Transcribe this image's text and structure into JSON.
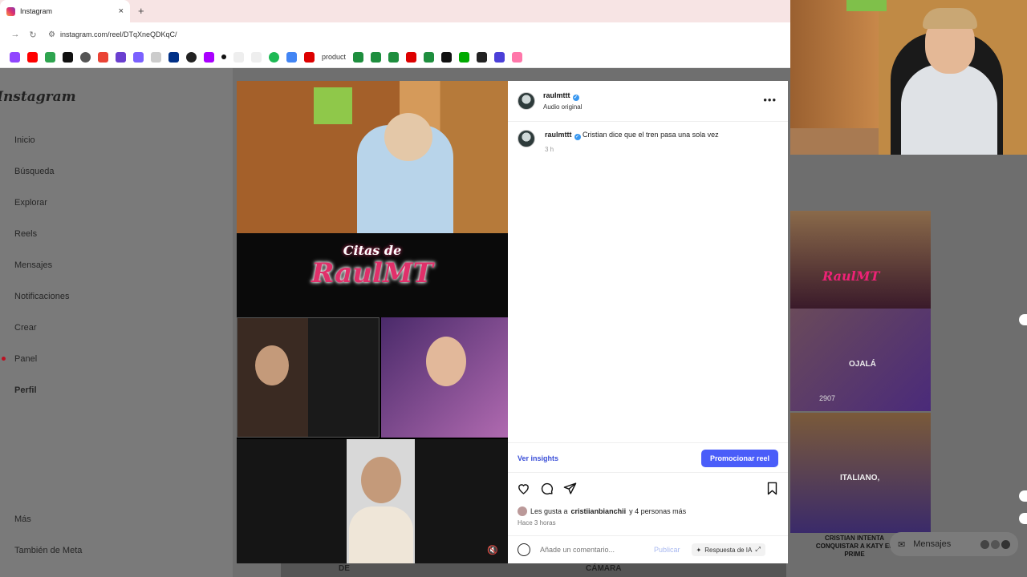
{
  "browser": {
    "tab_title": "Instagram",
    "new_tab": "+",
    "close": "×",
    "url": "instagram.com/reel/DTqXneQDKqC/",
    "bookmark_text": "product"
  },
  "sidebar": {
    "logo": "Instagram",
    "items": [
      {
        "label": "Inicio"
      },
      {
        "label": "Búsqueda"
      },
      {
        "label": "Explorar"
      },
      {
        "label": "Reels"
      },
      {
        "label": "Mensajes"
      },
      {
        "label": "Notificaciones"
      },
      {
        "label": "Crear"
      },
      {
        "label": "Panel"
      },
      {
        "label": "Perfil"
      },
      {
        "label": "Más"
      },
      {
        "label": "También de Meta"
      }
    ]
  },
  "post": {
    "username": "raulmttt",
    "audio": "Audio original",
    "caption": "Cristian dice que el tren pasa una sola vez",
    "caption_time": "3 h",
    "insights": "Ver insights",
    "promote": "Promocionar reel",
    "likes_prefix": "Les gusta a",
    "likes_user": "cristiianbianchii",
    "likes_suffix": "y 4 personas más",
    "time_ago": "Hace 3 horas",
    "comment_placeholder": "Añade un comentario...",
    "publish": "Publicar",
    "ai_reply": "Respuesta de IA",
    "more": "•••"
  },
  "video": {
    "banner_line1": "Citas de",
    "banner_line2": "RaulMT"
  },
  "right_panel": {
    "thumb_caption": "CRISTIAN INTENTA CONQUISTAR A KATY EL PRIME",
    "messages": "Mensajes",
    "thumb_text_1": "OJALÁ",
    "thumb_text_2": "ITALIANO,",
    "thumb_count": "2907",
    "bottom_1": "DE",
    "bottom_2": "CÁMARA"
  },
  "colors": {
    "accent": "#4a5df9",
    "link": "#3a4fd8",
    "verified": "#3897f0"
  }
}
